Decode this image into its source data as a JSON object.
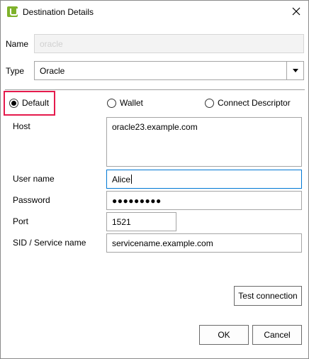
{
  "window": {
    "title": "Destination Details",
    "app_icon": "unifi-logo-icon",
    "close_icon": "close-icon"
  },
  "form": {
    "name": {
      "label": "Name",
      "value": "oracle"
    },
    "type": {
      "label": "Type",
      "value": "Oracle"
    },
    "connection_mode": {
      "options": [
        "Default",
        "Wallet",
        "Connect Descriptor"
      ],
      "selected": "Default"
    },
    "host": {
      "label": "Host",
      "value": "oracle23.example.com"
    },
    "user_name": {
      "label": "User name",
      "value": "Alice"
    },
    "password": {
      "label": "Password",
      "value": "●●●●●●●●●"
    },
    "port": {
      "label": "Port",
      "value": "1521"
    },
    "sid": {
      "label": "SID / Service name",
      "value": "servicename.example.com"
    }
  },
  "buttons": {
    "test_connection": "Test connection",
    "ok": "OK",
    "cancel": "Cancel"
  },
  "colors": {
    "highlight": "#e51a4c",
    "focus": "#0078d4",
    "brand": "#7fb22b"
  }
}
